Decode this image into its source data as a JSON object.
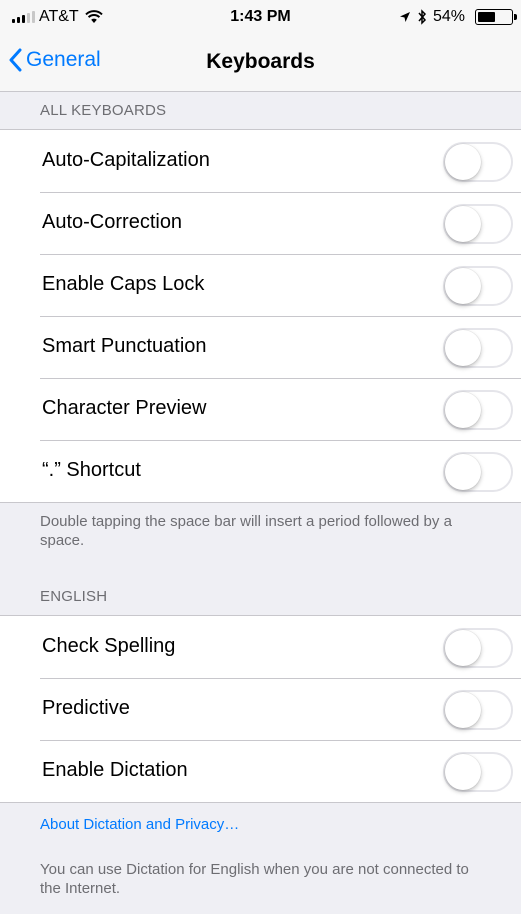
{
  "status_bar": {
    "carrier": "AT&T",
    "time": "1:43 PM",
    "battery_percent": "54%",
    "battery_level": 0.54,
    "icons": [
      "signal-icon",
      "wifi-icon",
      "location-icon",
      "bluetooth-icon",
      "battery-icon"
    ]
  },
  "nav": {
    "back_label": "General",
    "title": "Keyboards"
  },
  "sections": {
    "all_keyboards": {
      "header": "ALL KEYBOARDS",
      "rows": [
        {
          "label": "Auto-Capitalization",
          "on": false
        },
        {
          "label": "Auto-Correction",
          "on": false
        },
        {
          "label": "Enable Caps Lock",
          "on": false
        },
        {
          "label": "Smart Punctuation",
          "on": false
        },
        {
          "label": "Character Preview",
          "on": false
        },
        {
          "label": "“.” Shortcut",
          "on": false
        }
      ],
      "footer": "Double tapping the space bar will insert a period followed by a space."
    },
    "english": {
      "header": "ENGLISH",
      "rows": [
        {
          "label": "Check Spelling",
          "on": false
        },
        {
          "label": "Predictive",
          "on": false
        },
        {
          "label": "Enable Dictation",
          "on": false
        }
      ],
      "link": "About Dictation and Privacy…",
      "footer": "You can use Dictation for English when you are not connected to the Internet."
    }
  },
  "colors": {
    "accent": "#007aff",
    "background": "#efeff4",
    "toggle_off_border": "#e5e5ea"
  }
}
